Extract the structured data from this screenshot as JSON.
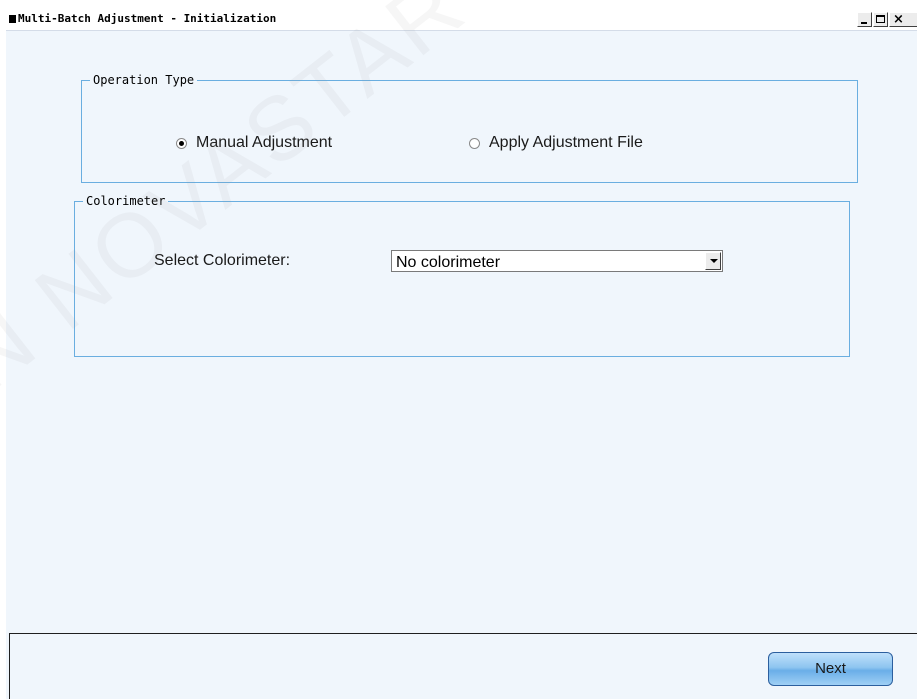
{
  "window": {
    "title": "Multi-Batch Adjustment - Initialization",
    "controls": {
      "minimize": "_",
      "maximize": "□",
      "close": "×"
    }
  },
  "operation_type": {
    "label": "Operation Type",
    "options": [
      {
        "label": "Manual Adjustment",
        "selected": true
      },
      {
        "label": "Apply Adjustment File",
        "selected": false
      }
    ]
  },
  "colorimeter": {
    "label": "Colorimeter",
    "select_label": "Select Colorimeter:",
    "select_value": "No colorimeter"
  },
  "footer": {
    "next_label": "Next"
  },
  "watermark": "N NOVASTAR TECH C",
  "colors": {
    "panel_bg": "#f0f6fc",
    "group_border": "#6aaee0",
    "button_blue": "#8ec5f0"
  }
}
